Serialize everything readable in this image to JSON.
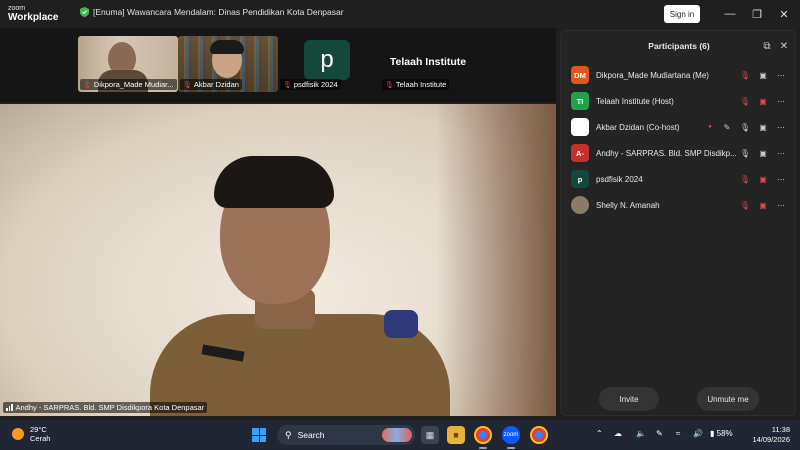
{
  "titlebar": {
    "brand_small": "zoom",
    "brand_large": "Workplace",
    "meeting_title": "[Enuma] Wawancara Mendalam: Dinas Pendidikan Kota Denpasar",
    "signin_label": "Sign in"
  },
  "strip": {
    "tiles": [
      {
        "label": "Dikpora_Made Mudiar..."
      },
      {
        "label": "Akbar Dzidan"
      },
      {
        "label": "psdfisik 2024",
        "avatar_letter": "p"
      },
      {
        "label": "Telaah Institute",
        "display_name": "Telaah Institute"
      }
    ]
  },
  "main_video": {
    "label": "Andhy - SARPRAS. Bld. SMP Disdikpora Kota Denpasar"
  },
  "participants": {
    "title": "Participants (6)",
    "items": [
      {
        "initials": "DM",
        "name": "Dikpora_Made Mudiartana (Me)",
        "avatar_color": "#e0561c",
        "audio": "muted",
        "video": "on"
      },
      {
        "initials": "TI",
        "name": "Telaah Institute (Host)",
        "avatar_color": "#22a04b",
        "audio": "muted",
        "video": "off"
      },
      {
        "initials": "",
        "name": "Akbar Dzidan (Co-host)",
        "avatar_color": "#ffffff",
        "audio": "on",
        "video": "on"
      },
      {
        "initials": "A-",
        "name": "Andhy - SARPRAS. Bld. SMP Disdikp...",
        "avatar_color": "#c4302b",
        "audio": "on",
        "video": "on"
      },
      {
        "initials": "p",
        "name": "psdfisik 2024",
        "avatar_color": "#14483a",
        "audio": "muted",
        "video": "off"
      },
      {
        "initials": "",
        "name": "Shelly N. Amanah",
        "avatar_color": "#8a7a6a",
        "audio": "muted",
        "video": "off"
      }
    ],
    "invite_label": "Invite",
    "unmute_label": "Unmute me"
  },
  "taskbar": {
    "temperature": "29°C",
    "weather": "Cerah",
    "search_label": "Search",
    "battery": "58%",
    "time": "11:38",
    "date": "14/09/2026"
  }
}
